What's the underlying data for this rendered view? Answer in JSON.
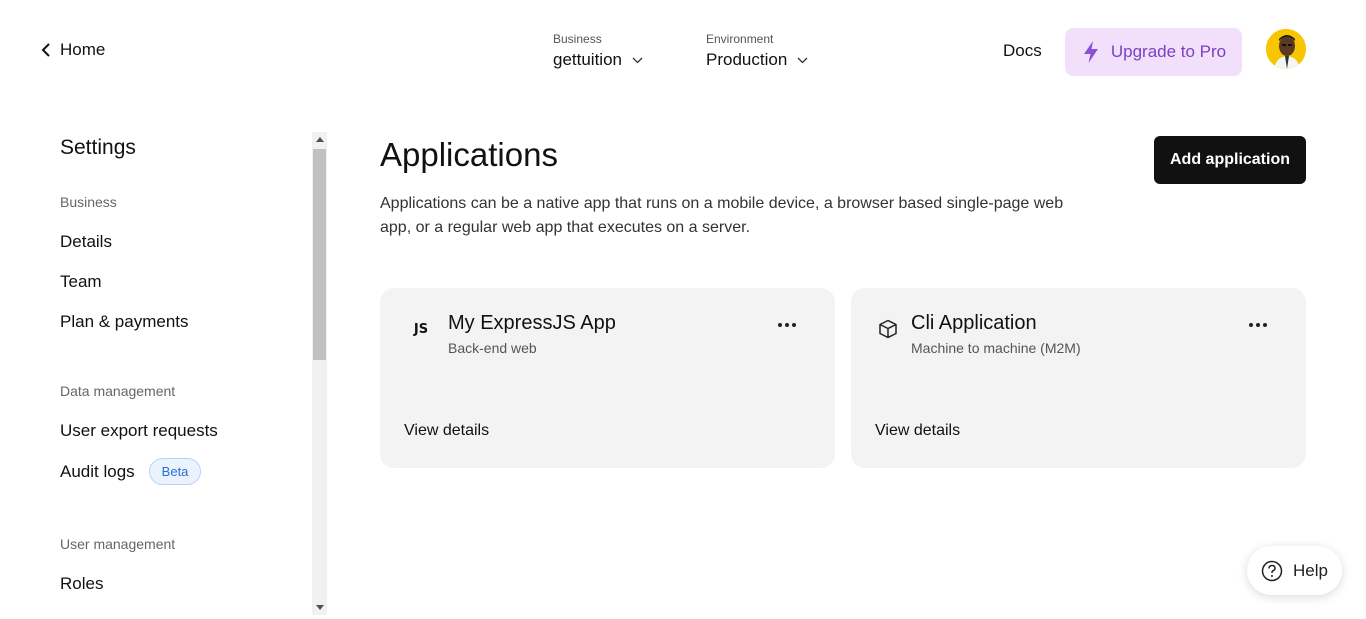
{
  "header": {
    "back_label": "Home",
    "business": {
      "label": "Business",
      "value": "gettuition"
    },
    "environment": {
      "label": "Environment",
      "value": "Production"
    },
    "docs_label": "Docs",
    "upgrade_label": "Upgrade to Pro"
  },
  "sidebar": {
    "title": "Settings",
    "sections": [
      {
        "label": "Business",
        "items": [
          "Details",
          "Team",
          "Plan & payments"
        ]
      },
      {
        "label": "Data management",
        "items": [
          "User export requests",
          "Audit logs"
        ]
      },
      {
        "label": "User management",
        "items": [
          "Roles"
        ]
      }
    ],
    "audit_badge": "Beta"
  },
  "main": {
    "title": "Applications",
    "add_button": "Add application",
    "description": "Applications can be a native app that runs on a mobile device, a browser based single-page web app, or a regular web app that executes on a server.",
    "apps": [
      {
        "icon": "js-icon",
        "icon_text": "JS",
        "name": "My ExpressJS App",
        "type": "Back-end web",
        "view_label": "View details"
      },
      {
        "icon": "cube-icon",
        "name": "Cli Application",
        "type": "Machine to machine (M2M)",
        "view_label": "View details"
      }
    ]
  },
  "help_label": "Help",
  "colors": {
    "upgrade_bg": "#f2e0fb",
    "upgrade_text": "#7b3fc4",
    "primary_button": "#111111",
    "card_bg": "#f3f3f3",
    "beta_text": "#2a6fd6"
  }
}
